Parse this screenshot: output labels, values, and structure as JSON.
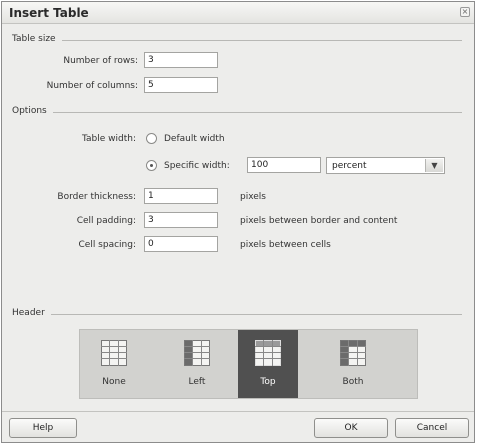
{
  "dialog": {
    "title": "Insert Table",
    "close_glyph": "×"
  },
  "table_size": {
    "section_label": "Table size",
    "rows_label": "Number of rows:",
    "rows_value": "3",
    "columns_label": "Number of columns:",
    "columns_value": "5"
  },
  "options": {
    "section_label": "Options",
    "table_width_label": "Table width:",
    "default_width_label": "Default width",
    "specific_width_label": "Specific width:",
    "specific_width_value": "100",
    "width_unit_selected": "percent",
    "selected_width_mode": "specific",
    "border_label": "Border thickness:",
    "border_value": "1",
    "border_unit": "pixels",
    "padding_label": "Cell padding:",
    "padding_value": "3",
    "padding_unit": "pixels between border and content",
    "spacing_label": "Cell spacing:",
    "spacing_value": "0",
    "spacing_unit": "pixels between cells"
  },
  "header": {
    "section_label": "Header",
    "options": [
      {
        "label": "None",
        "icon": "header-none-icon"
      },
      {
        "label": "Left",
        "icon": "header-left-icon"
      },
      {
        "label": "Top",
        "icon": "header-top-icon"
      },
      {
        "label": "Both",
        "icon": "header-both-icon"
      }
    ],
    "selected": "Top",
    "selected_color": "#505050"
  },
  "footer": {
    "help_label": "Help",
    "ok_label": "OK",
    "cancel_label": "Cancel"
  }
}
